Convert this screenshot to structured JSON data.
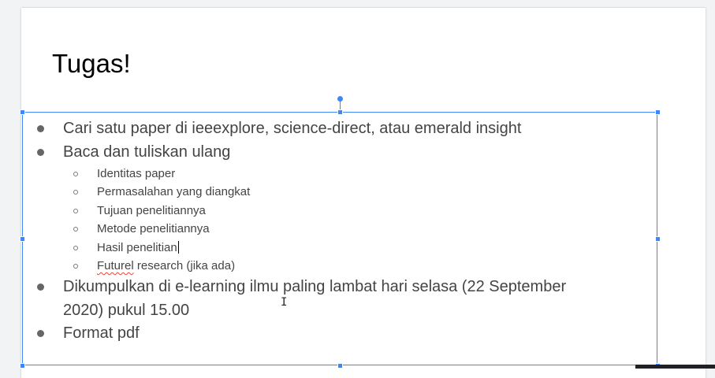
{
  "slide": {
    "title": "Tugas!",
    "bullets": [
      "Cari satu paper di ieeexplore, science-direct, atau emerald insight",
      "Baca dan tuliskan ulang"
    ],
    "sub_bullets": [
      "Identitas paper",
      "Permasalahan yang diangkat",
      "Tujuan penelitiannya",
      "Metode penelitiannya",
      "Hasil penelitian"
    ],
    "sub_last_misspelled": "Futurel",
    "sub_last_rest": " research (jika ada)",
    "bullet3_line1": "Dikumpulkan di e-learning ilmu paling lambat hari selasa (22 September",
    "bullet3_line2": "2020) pukul 15.00",
    "bullet4": "Format pdf"
  },
  "colors": {
    "selection": "#4285f4",
    "text": "#444444",
    "spellcheck": "#ea4335"
  },
  "icons": {
    "cursor": "i-beam-cursor-icon"
  }
}
